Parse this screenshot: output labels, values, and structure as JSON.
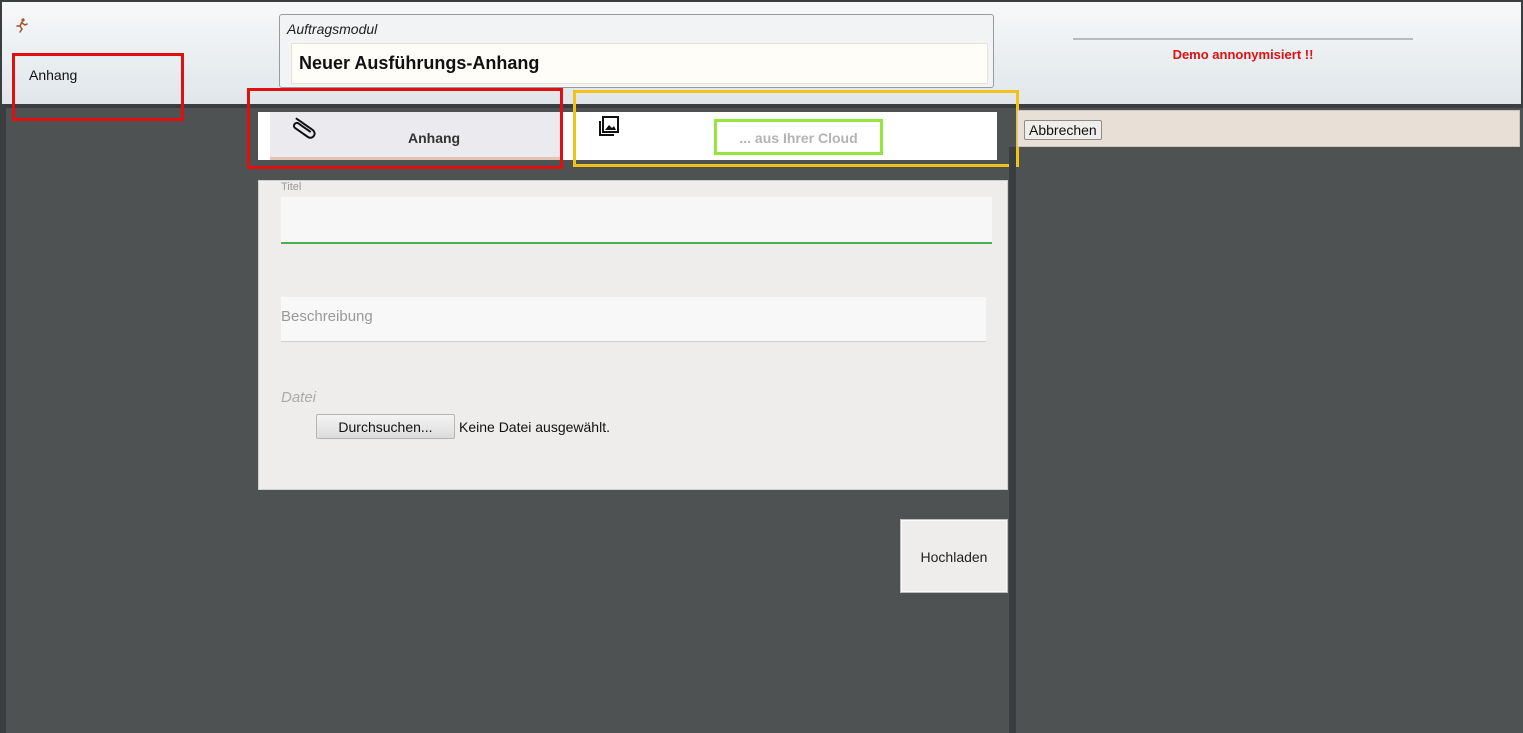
{
  "colors": {
    "highlight_red": "#e01010",
    "highlight_yellow": "#f2c21a",
    "highlight_green": "#95e63c",
    "demo_text": "#dd1111",
    "input_active_underline": "#4caf50",
    "background_dark": "#4f5253"
  },
  "icons": {
    "app_logo": "runner-icon",
    "attachment_tab": "paperclip-icon",
    "cloud_tab": "photo-library-icon"
  },
  "nav": {
    "crumb_label": "Anhang"
  },
  "header": {
    "module_label": "Auftragsmodul",
    "title": "Neuer Ausführungs-Anhang",
    "demo_notice": "Demo annonymisiert !!"
  },
  "tabs": [
    {
      "label": "Anhang"
    },
    {
      "label": "... aus Ihrer Cloud"
    }
  ],
  "actions": {
    "cancel": "Abbrechen",
    "upload": "Hochladen"
  },
  "form": {
    "title_label": "Titel",
    "title_value": "",
    "description_placeholder": "Beschreibung",
    "file_label": "Datei",
    "browse_button": "Durchsuchen...",
    "no_file_text": "Keine Datei ausgewählt."
  }
}
